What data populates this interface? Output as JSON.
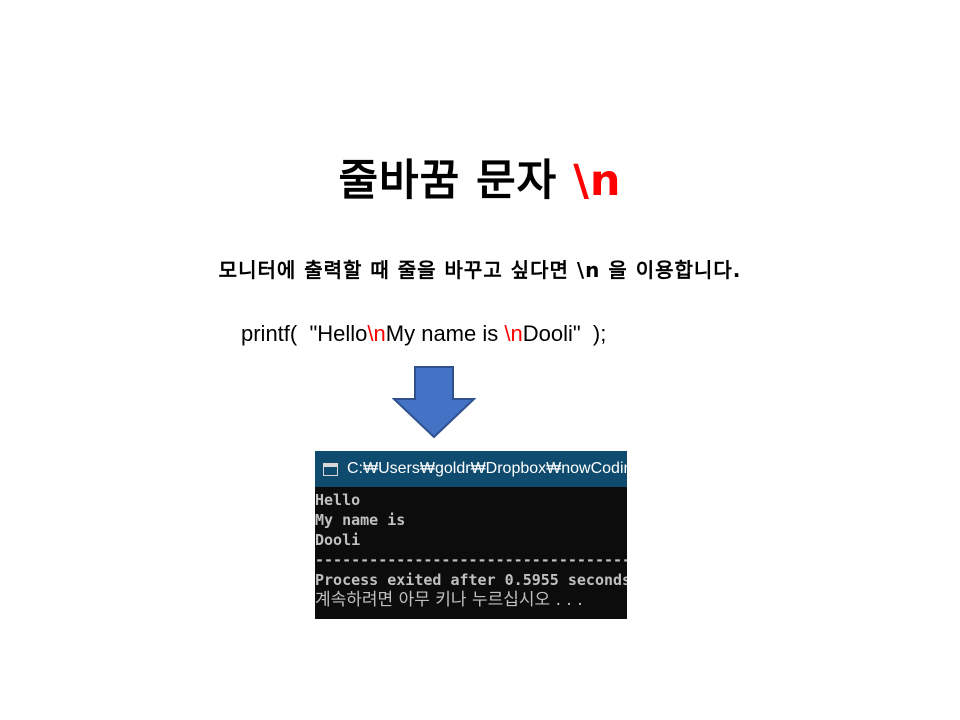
{
  "title": {
    "main": "줄바꿈 문자 ",
    "escape": "\\n"
  },
  "subtitle": "모니터에 출력할 때 줄을 바꾸고 싶다면 \\n 을 이용합니다.",
  "code": {
    "prefix": "printf(  \"Hello",
    "esc1": "\\n",
    "middle": "My name is ",
    "esc2": "\\n",
    "suffix": "Dooli\"  );"
  },
  "arrow": {
    "icon": "down-arrow-icon",
    "fill": "#4472c4",
    "stroke": "#2f528f"
  },
  "console": {
    "title": "C:₩Users₩goldr₩Dropbox₩nowCoding",
    "lines": [
      "Hello",
      "My name is",
      "Dooli",
      "--------------------------------------------",
      "Process exited after 0.5955 seconds",
      "계속하려면 아무 키나 누르십시오 . . ."
    ]
  },
  "colors": {
    "accent": "#ff0000",
    "console_bg": "#0c0c0c",
    "titlebar_bg": "#0f4b6e"
  }
}
